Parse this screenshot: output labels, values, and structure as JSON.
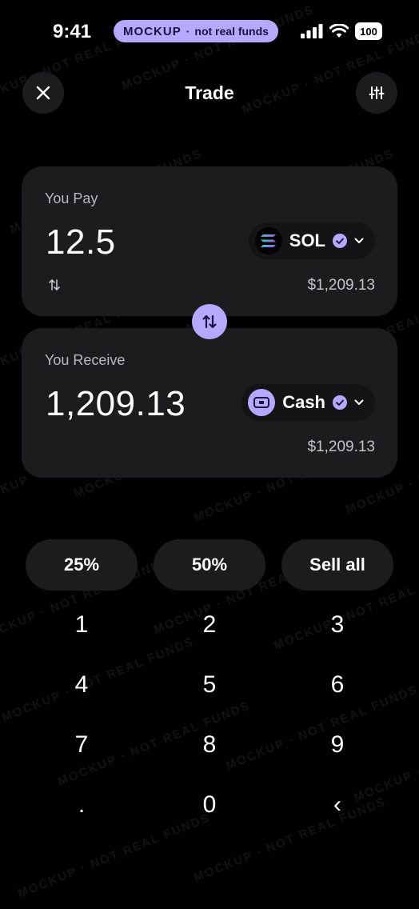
{
  "status_bar": {
    "time": "9:41",
    "banner_strong": "MOCKUP",
    "banner_sep": "·",
    "banner_light": "not real funds",
    "battery": "100"
  },
  "header": {
    "title": "Trade"
  },
  "pay_card": {
    "label": "You Pay",
    "amount": "12.5",
    "token": "SOL",
    "usd_value": "$1,209.13"
  },
  "receive_card": {
    "label": "You Receive",
    "amount": "1,209.13",
    "token": "Cash",
    "usd_value": "$1,209.13"
  },
  "quick_amounts": [
    "25%",
    "50%",
    "Sell all"
  ],
  "keypad": [
    "1",
    "2",
    "3",
    "4",
    "5",
    "6",
    "7",
    "8",
    "9",
    ".",
    "0",
    "‹"
  ],
  "watermark_text": "MOCKUP · NOT REAL FUNDS",
  "colors": {
    "accent": "#b7a8ff",
    "card": "#1c1c1e",
    "background": "#000000"
  }
}
